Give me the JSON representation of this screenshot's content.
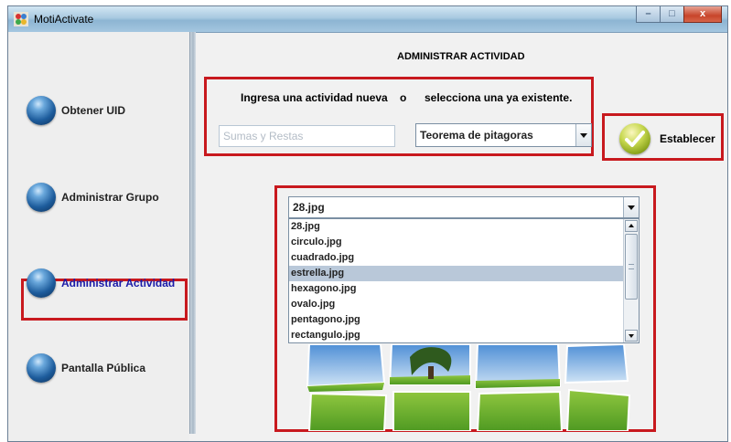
{
  "window": {
    "title": "MotiActivate",
    "minimize_label": "–",
    "maximize_label": "□",
    "close_label": "x"
  },
  "sidebar": {
    "items": [
      {
        "label": "Obtener UID",
        "active": false
      },
      {
        "label": "Administrar Grupo",
        "active": false
      },
      {
        "label": "Administrar Actividad",
        "active": true
      },
      {
        "label": "Pantalla Pública",
        "active": false
      }
    ]
  },
  "main": {
    "title": "ADMINISTRAR ACTIVIDAD",
    "prompt_left": "Ingresa una actividad nueva",
    "prompt_or": "o",
    "prompt_right": "selecciona una ya existente.",
    "new_activity": {
      "placeholder": "Sumas y Restas",
      "value": ""
    },
    "activity_select": {
      "selected": "Teorema de pitagoras"
    },
    "set_button": {
      "label": "Establecer",
      "icon": "check-icon"
    },
    "image_select": {
      "selected": "28.jpg",
      "options": [
        "28.jpg",
        "circulo.jpg",
        "cuadrado.jpg",
        "estrella.jpg",
        "hexagono.jpg",
        "ovalo.jpg",
        "pentagono.jpg",
        "rectangulo.jpg"
      ],
      "highlighted": "estrella.jpg"
    }
  },
  "colors": {
    "highlight_frame": "#c8191e",
    "active_nav_text": "#1a1aa8",
    "list_selection": "#b9c8d9"
  }
}
